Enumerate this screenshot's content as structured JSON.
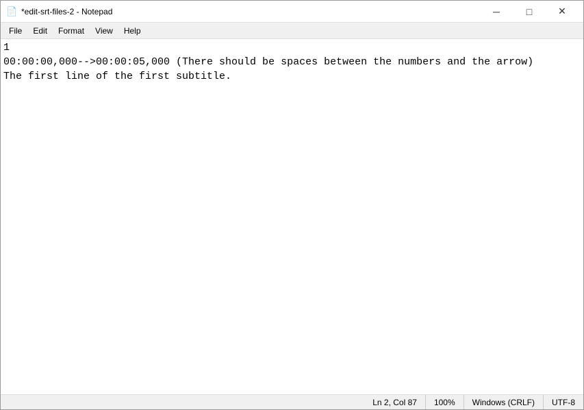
{
  "window": {
    "title": "*edit-srt-files-2 - Notepad",
    "icon": "📄"
  },
  "titlebar": {
    "minimize_label": "─",
    "maximize_label": "□",
    "close_label": "✕"
  },
  "menu": {
    "items": [
      {
        "label": "File"
      },
      {
        "label": "Edit"
      },
      {
        "label": "Format"
      },
      {
        "label": "View"
      },
      {
        "label": "Help"
      }
    ]
  },
  "editor": {
    "content": "1\n00:00:00,000-->00:00:05,000 (There should be spaces between the numbers and the arrow)\nThe first line of the first subtitle."
  },
  "statusbar": {
    "position": "Ln 2, Col 87",
    "zoom": "100%",
    "line_ending": "Windows (CRLF)",
    "encoding": "UTF-8"
  }
}
